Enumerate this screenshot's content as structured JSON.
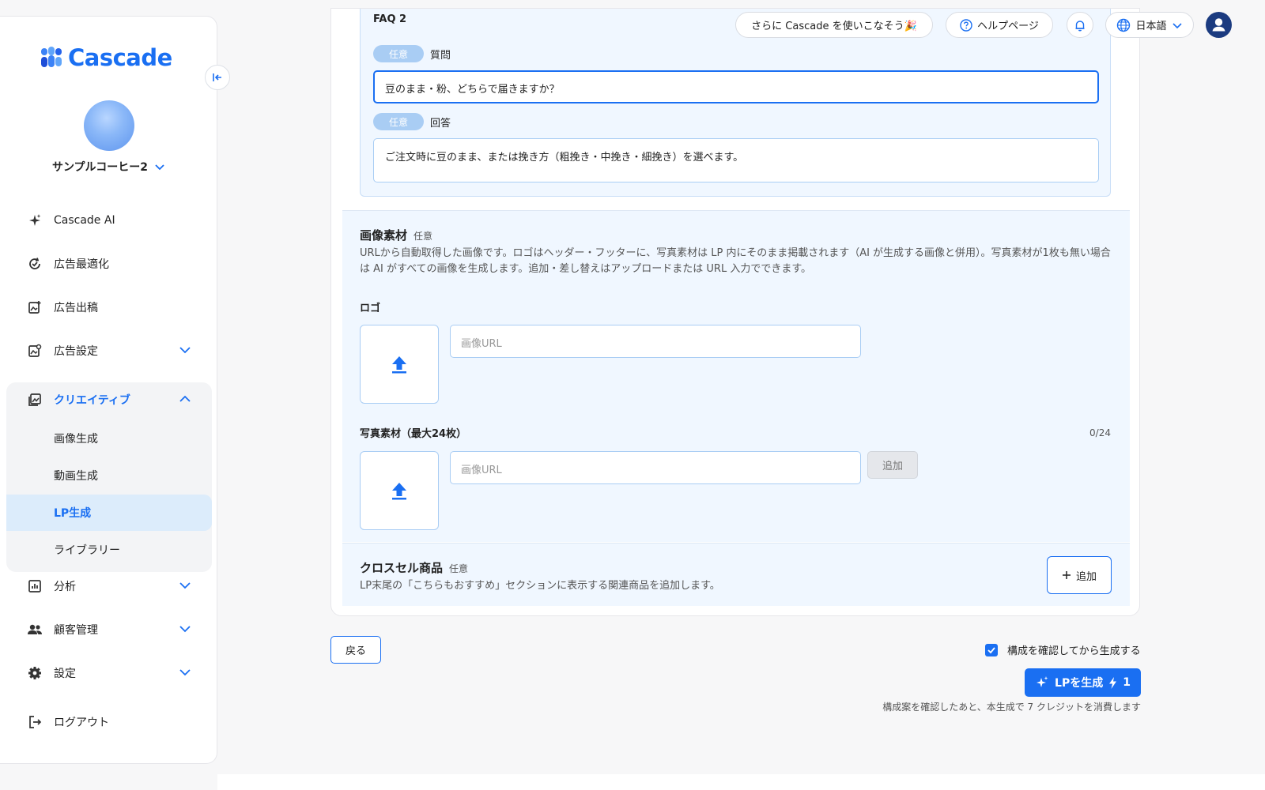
{
  "brand": {
    "name": "Cascade",
    "accent": "#1a6ff2"
  },
  "account": {
    "name": "サンプルコーヒー2"
  },
  "nav": {
    "cascade_ai": "Cascade AI",
    "ad_optimize": "広告最適化",
    "ad_publish": "広告出稿",
    "ad_settings": "広告設定",
    "creative": "クリエイティブ",
    "sub": {
      "image_gen": "画像生成",
      "video_gen": "動画生成",
      "lp_gen": "LP生成",
      "library": "ライブラリー"
    },
    "analytics": "分析",
    "customers": "顧客管理",
    "settings": "設定",
    "logout": "ログアウト"
  },
  "header": {
    "promo": "さらに Cascade を使いこなそう🎉",
    "help": "ヘルプページ",
    "language": "日本語"
  },
  "faq": {
    "title": "FAQ 2",
    "optional_tag": "任意",
    "question_label": "質問",
    "question_value": "豆のまま・粉、どちらで届きますか？",
    "answer_label": "回答",
    "answer_value": "ご注文時に豆のまま、または挽き方（粗挽き・中挽き・細挽き）を選べます。"
  },
  "images": {
    "title": "画像素材",
    "optional": "任意",
    "description": "URLから自動取得した画像です。ロゴはヘッダー・フッターに、写真素材は LP 内にそのまま掲載されます（AI が生成する画像と併用）。写真素材が1枚も無い場合は AI がすべての画像を生成します。追加・差し替えはアップロードまたは URL 入力でできます。",
    "logo_label": "ロゴ",
    "url_placeholder": "画像URL",
    "photos_label": "写真素材（最大24枚）",
    "photos_count": "0/24",
    "add_label": "追加"
  },
  "crosssell": {
    "title": "クロスセル商品",
    "optional": "任意",
    "description": "LP末尾の「こちらもおすすめ」セクションに表示する関連商品を追加します。",
    "add_label": "追加"
  },
  "footer": {
    "back_label": "戻る",
    "confirm_label": "構成を確認してから生成する",
    "generate_label": "LPを生成",
    "credit_cost": "1",
    "note": "構成案を確認したあと、本生成で 7 クレジットを消費します"
  }
}
